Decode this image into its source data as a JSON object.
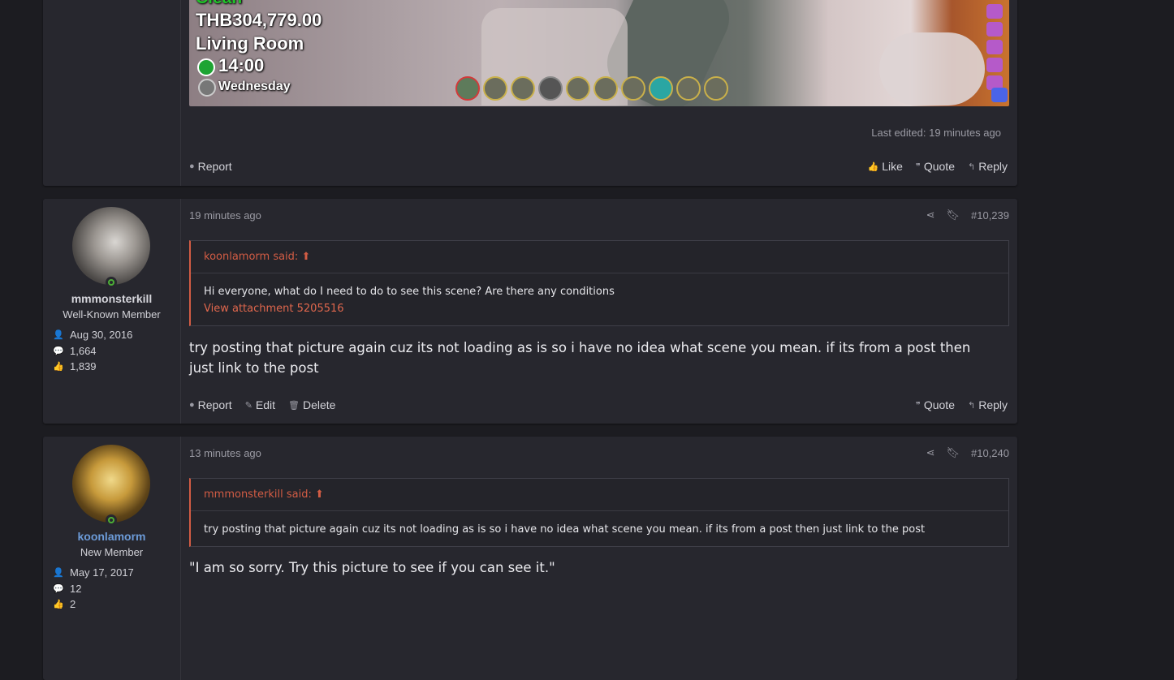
{
  "post1": {
    "hud": {
      "status": "Clean",
      "money": "THB304,779.00",
      "location": "Living Room",
      "time": "14:00",
      "day": "Wednesday"
    },
    "last_edited": "Last edited: 19 minutes ago",
    "actions_left": [
      "Report"
    ],
    "actions_right": [
      "Like",
      "Quote",
      "Reply"
    ]
  },
  "post2": {
    "user": {
      "name": "mmmonsterkill",
      "title": "Well-Known Member",
      "joined": "Aug 30, 2016",
      "messages": "1,664",
      "reactions": "1,839"
    },
    "time": "19 minutes ago",
    "number": "#10,239",
    "quote": {
      "author": "koonlamorm said:",
      "text": "Hi everyone, what do I need to do to see this scene? Are there any conditions",
      "link": "View attachment 5205516"
    },
    "body": "try posting that picture again cuz its not loading as is so i have no idea what scene you mean. if its from a post then just link to the post",
    "actions_left": [
      "Report",
      "Edit",
      "Delete"
    ],
    "actions_right": [
      "Quote",
      "Reply"
    ]
  },
  "post3": {
    "user": {
      "name": "koonlamorm",
      "title": "New Member",
      "joined": "May 17, 2017",
      "messages": "12",
      "reactions": "2"
    },
    "time": "13 minutes ago",
    "number": "#10,240",
    "quote": {
      "author": "mmmonsterkill said:",
      "text": "try posting that picture again cuz its not loading as is so i have no idea what scene you mean. if its from a post then just link to the post"
    },
    "body": "\"I am so sorry. Try this picture to see if you can see it.\""
  },
  "colors": {
    "accent_red": "#d25c44",
    "username_blue": "#6c9bd8",
    "online_green": "#4caf36"
  }
}
